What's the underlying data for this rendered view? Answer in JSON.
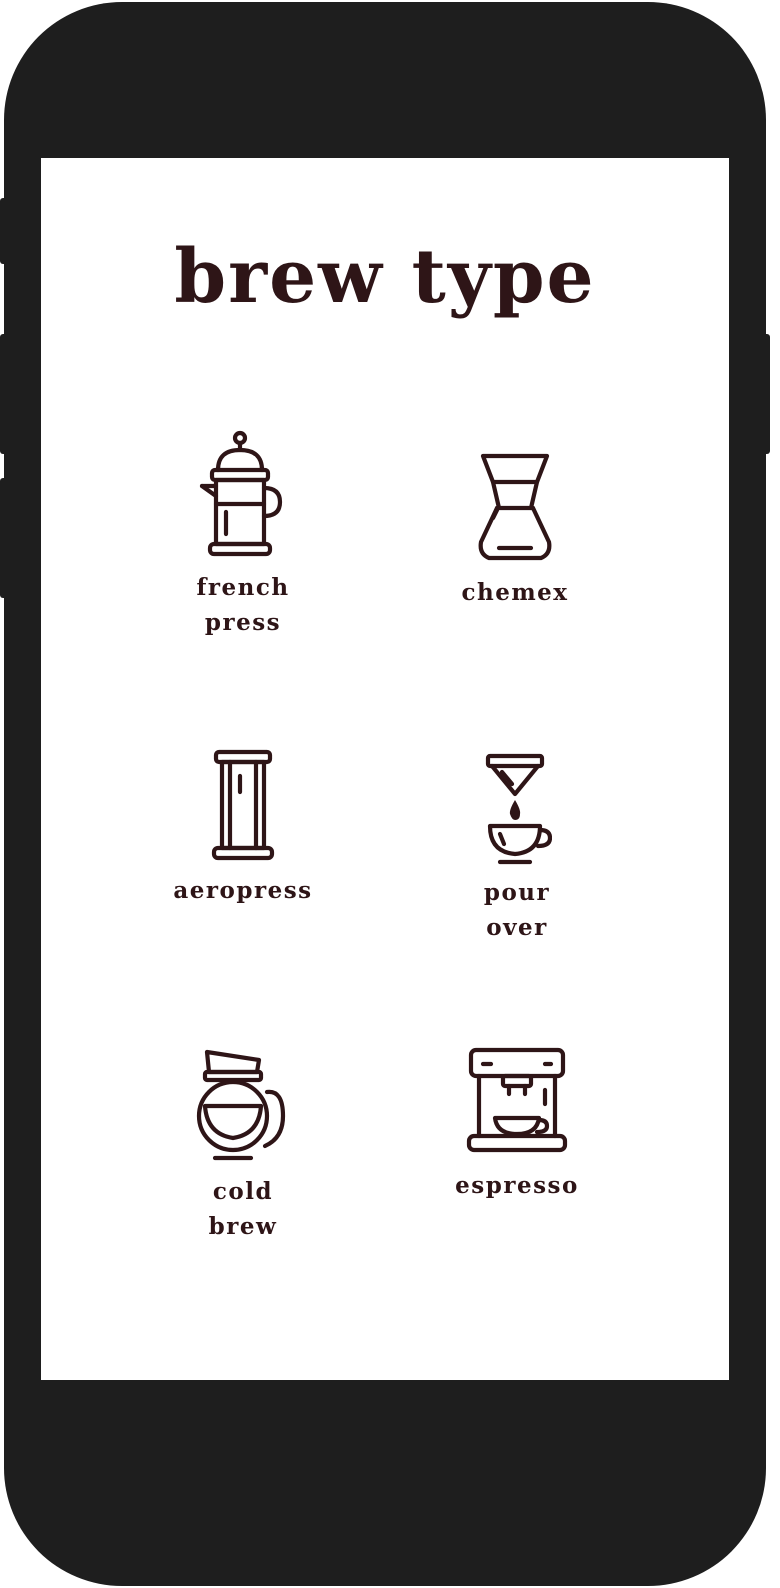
{
  "screen": {
    "title": "brew type"
  },
  "brew_types": [
    {
      "label": "french press",
      "icon": "french-press-icon"
    },
    {
      "label": "chemex",
      "icon": "chemex-icon"
    },
    {
      "label": "aeropress",
      "icon": "aeropress-icon"
    },
    {
      "label": "pour over",
      "icon": "pour-over-icon"
    },
    {
      "label": "cold brew",
      "icon": "cold-brew-icon"
    },
    {
      "label": "espresso",
      "icon": "espresso-machine-icon"
    }
  ],
  "colors": {
    "accent": "#2e1517",
    "device": "#1e1e1e",
    "screen_background": "#ffffff"
  }
}
